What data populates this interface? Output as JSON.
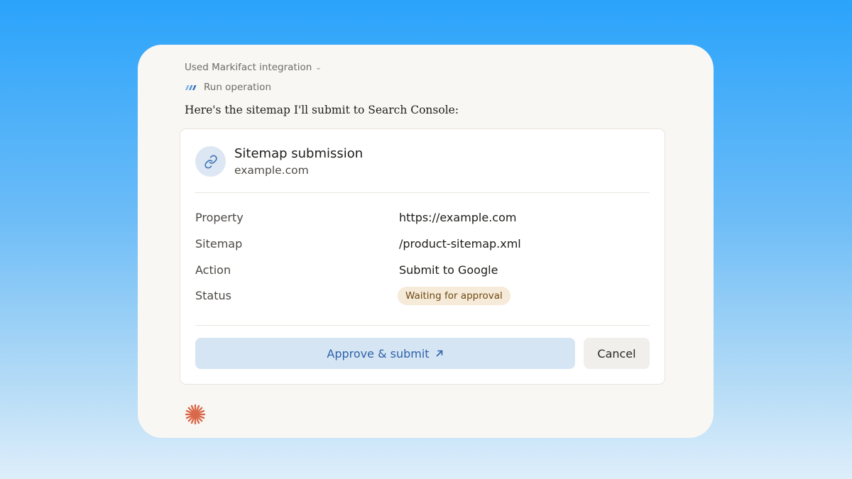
{
  "header": {
    "integration_label": "Used Markifact integration",
    "run_operation_label": "Run operation"
  },
  "message": {
    "intro": "Here's the sitemap I'll submit to Search Console:"
  },
  "card": {
    "title": "Sitemap submission",
    "subtitle": "example.com",
    "rows": [
      {
        "label": "Property",
        "value": "https://example.com"
      },
      {
        "label": "Sitemap",
        "value": "/product-sitemap.xml"
      },
      {
        "label": "Action",
        "value": "Submit to Google"
      },
      {
        "label": "Status",
        "value": "Waiting for approval"
      }
    ],
    "approve_label": "Approve & submit",
    "cancel_label": "Cancel"
  },
  "icons": {
    "integration_dropdown": "chevron-down-icon",
    "markifact_logo": "markifact-logo-icon",
    "card_icon": "link-icon",
    "approve_icon": "arrow-up-right-icon",
    "assistant": "asterisk-spark-icon"
  },
  "colors": {
    "status_badge_bg": "#f6ead9",
    "status_badge_text": "#6e4a14",
    "approve_bg": "#d6e5f4",
    "approve_text": "#2d63a8",
    "spark": "#d9694a"
  }
}
